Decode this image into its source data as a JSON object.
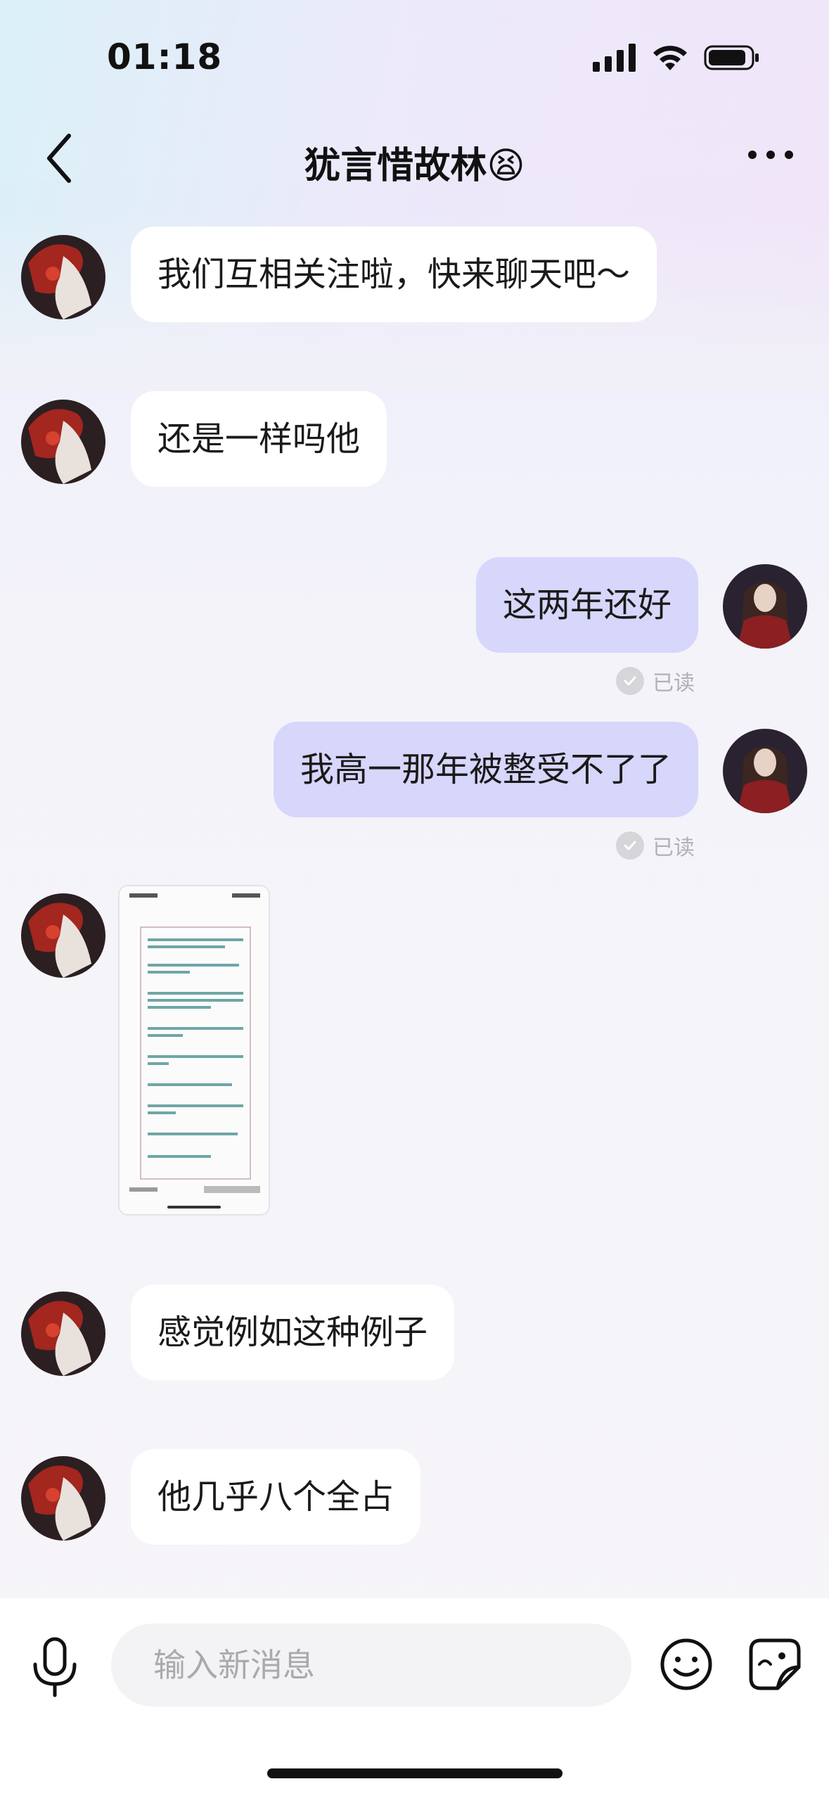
{
  "status_bar": {
    "time": "01:18"
  },
  "header": {
    "title": "犹言惜故林😫"
  },
  "messages": [
    {
      "side": "in",
      "text": "我们互相关注啦，快来聊天吧～"
    },
    {
      "side": "in",
      "text": "还是一样吗他"
    },
    {
      "side": "out",
      "text": "这两年还好",
      "read_status": "已读"
    },
    {
      "side": "out",
      "text": "我高一那年被整受不了了",
      "read_status": "已读"
    },
    {
      "side": "in",
      "type": "image",
      "icon": "screenshot-thumbnail"
    },
    {
      "side": "in",
      "text": "感觉例如这种例子"
    },
    {
      "side": "in",
      "text": "他几乎八个全占"
    }
  ],
  "input": {
    "placeholder": "输入新消息"
  },
  "colors": {
    "outgoing_bubble": "#d7d6fb",
    "incoming_bubble": "#ffffff",
    "background": "#f4f3f9"
  }
}
